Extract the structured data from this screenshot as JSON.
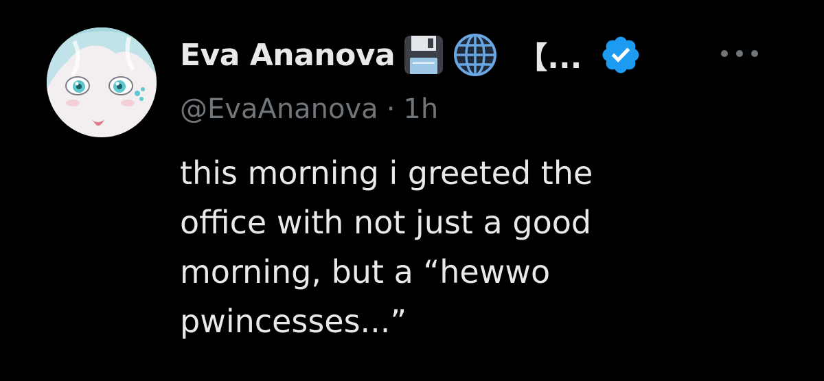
{
  "author": {
    "display_name": "Eva Ananova",
    "name_suffix": "【...",
    "handle": "@EvaAnanova",
    "separator": "·",
    "time": "1h",
    "icons": [
      "floppy-disk-icon",
      "globe-icon",
      "verified-badge-icon"
    ]
  },
  "tweet": {
    "lines": [
      "this morning i greeted the",
      "office with not just a good",
      "morning, but a “hewwo",
      "pwincesses...”"
    ]
  },
  "colors": {
    "background": "#000000",
    "text": "#e7e9ea",
    "secondary_text": "#71767b",
    "verified": "#1d9bf0"
  }
}
